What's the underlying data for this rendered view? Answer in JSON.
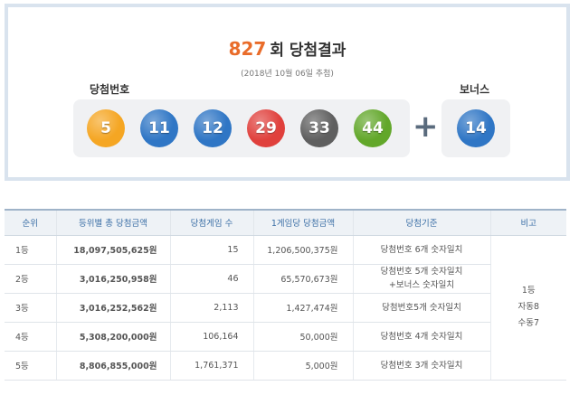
{
  "header": {
    "round": "827",
    "title_suffix": "회 당첨결과",
    "draw_date": "(2018년 10월 06일 추첨)",
    "winning_label": "당첨번호",
    "bonus_label": "보너스",
    "plus": "+"
  },
  "balls": [
    {
      "number": "5",
      "color": "#f5a623"
    },
    {
      "number": "11",
      "color": "#2f76c5"
    },
    {
      "number": "12",
      "color": "#2f76c5"
    },
    {
      "number": "29",
      "color": "#e0403c"
    },
    {
      "number": "33",
      "color": "#5f5f5f"
    },
    {
      "number": "44",
      "color": "#62a72a"
    }
  ],
  "bonus_ball": {
    "number": "14",
    "color": "#2f76c5"
  },
  "table": {
    "headers": [
      "순위",
      "등위별 총 당첨금액",
      "당첨게임 수",
      "1게임당 당첨금액",
      "당첨기준",
      "비고"
    ],
    "rows": [
      {
        "rank": "1등",
        "total": "18,097,505,625원",
        "count": "15",
        "per_game": "1,206,500,375원",
        "criteria": [
          "당첨번호 6개 숫자일치"
        ]
      },
      {
        "rank": "2등",
        "total": "3,016,250,958원",
        "count": "46",
        "per_game": "65,570,673원",
        "criteria": [
          "당첨번호 5개 숫자일치",
          "+보너스 숫자일치"
        ]
      },
      {
        "rank": "3등",
        "total": "3,016,252,562원",
        "count": "2,113",
        "per_game": "1,427,474원",
        "criteria": [
          "당첨번호5개 숫자일치"
        ]
      },
      {
        "rank": "4등",
        "total": "5,308,200,000원",
        "count": "106,164",
        "per_game": "50,000원",
        "criteria": [
          "당첨번호 4개 숫자일치"
        ]
      },
      {
        "rank": "5등",
        "total": "8,806,855,000원",
        "count": "1,761,371",
        "per_game": "5,000원",
        "criteria": [
          "당첨번호 3개 숫자일치"
        ]
      }
    ],
    "note": [
      "1등",
      "자동8",
      "수동7"
    ]
  }
}
